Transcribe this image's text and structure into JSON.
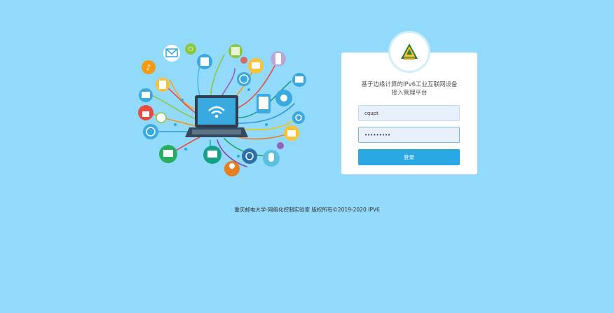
{
  "login": {
    "title_line1": "基于边缘计算的IPv6工业互联网设备",
    "title_line2": "接入管理平台",
    "username_value": "cqupt",
    "password_value": "•••••••••",
    "submit_label": "登录"
  },
  "footer": {
    "copyright": "重庆邮电大学-网络化控制实验室 版权所有©2019-2020 IPV6"
  },
  "colors": {
    "background": "#92dafb",
    "button": "#2aa8e3",
    "field_bg": "#e8f0fc"
  }
}
